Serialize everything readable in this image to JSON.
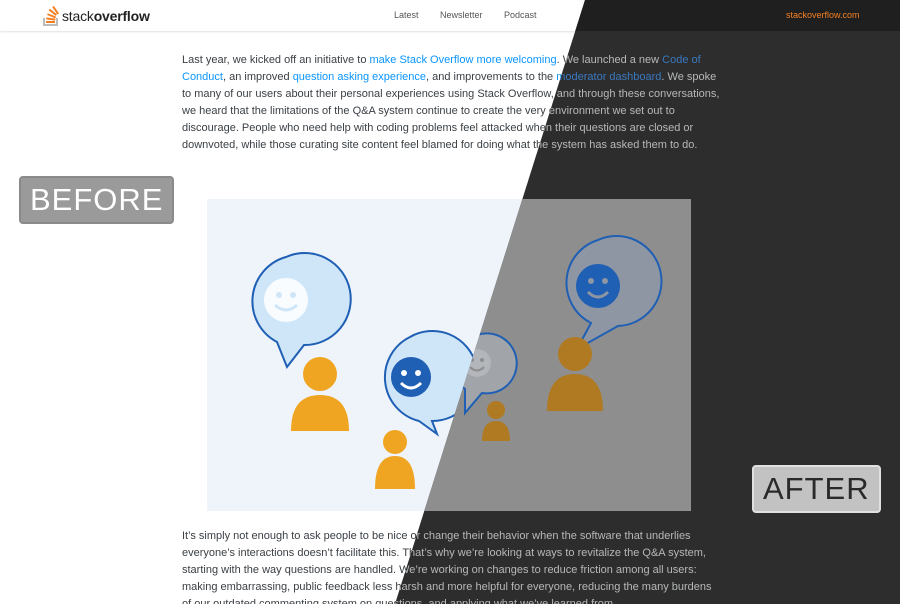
{
  "header": {
    "logo_text_regular": "stack",
    "logo_text_bold": "overflow",
    "nav": [
      "Latest",
      "Newsletter",
      "Podcast"
    ],
    "site_link": "stackoverflow.com"
  },
  "article": {
    "p1_before_link1": "Last year, we kicked off an initiative to ",
    "link1": "make Stack Overflow more welcoming",
    "p1_after_link1": ". We launched a new ",
    "link2": "Code of Conduct",
    "p1_after_link2": ", an improved ",
    "link3": "question asking experience",
    "p1_after_link3": ", and improvements to the ",
    "link4": "moderator dashboard",
    "p1_rest": ". We spoke to many of our users about their personal experiences using Stack Overflow, and through these conversations, we heard that the limitations of the Q&A system continue to create the very environment we set out to discourage. People who need help with coding problems feel attacked when their questions are closed or downvoted, while those curating site content feel blamed for doing what the system has asked them to do.",
    "p2": "It’s simply not enough to ask people to be nice or change their behavior when the software that underlies everyone’s interactions doesn’t facilitate this. That’s why we’re looking at ways to revitalize the Q&A system, starting with the way questions are handled. We’re working on changes to reduce friction among all users: making embarrassing, public feedback less harsh and more helpful for everyone, reducing the many burdens of our outdated commenting system on questions, and applying what we’ve learned from"
  },
  "labels": {
    "before": "BEFORE",
    "after": "AFTER"
  },
  "colors": {
    "link_light": "#0a95ff",
    "brand_orange": "#f48024",
    "bubble_fill": "#cfe6f9",
    "bubble_stroke": "#1f5fb4",
    "person": "#f0a522"
  }
}
